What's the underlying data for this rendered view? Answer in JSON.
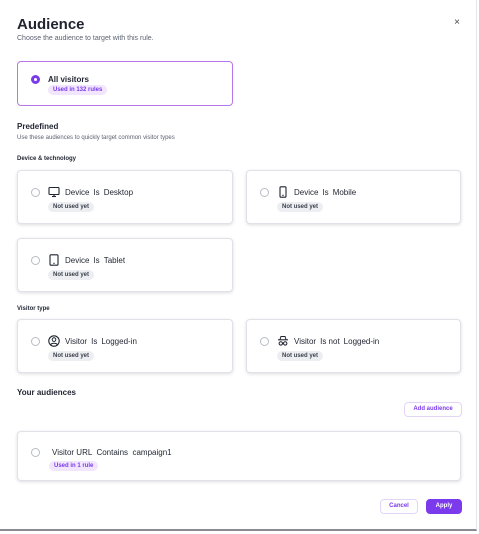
{
  "modal": {
    "title": "Audience",
    "subtitle": "Choose the audience to target with this rule.",
    "close_icon": "×"
  },
  "all_visitors": {
    "label": "All visitors",
    "badge": "Used in 132 rules",
    "selected": true
  },
  "predefined": {
    "title": "Predefined",
    "subtitle": "Use these audiences to quickly target common visitor types",
    "device_group": "Device & technology",
    "visitor_group": "Visitor type",
    "items": [
      {
        "subject": "Device",
        "op": "Is",
        "value": "Desktop",
        "badge": "Not used yet",
        "icon": "desktop-icon"
      },
      {
        "subject": "Device",
        "op": "Is",
        "value": "Mobile",
        "badge": "Not used yet",
        "icon": "mobile-icon"
      },
      {
        "subject": "Device",
        "op": "Is",
        "value": "Tablet",
        "badge": "Not used yet",
        "icon": "tablet-icon"
      },
      {
        "subject": "Visitor",
        "op": "Is",
        "value": "Logged-in",
        "badge": "Not used yet",
        "icon": "user-circle-icon"
      },
      {
        "subject": "Visitor",
        "op": "Is not",
        "value": "Logged-in",
        "badge": "Not used yet",
        "icon": "incognito-icon"
      }
    ]
  },
  "your_audiences": {
    "title": "Your audiences",
    "add_label": "Add audience",
    "items": [
      {
        "label": "Visitor URL  Contains  campaign1",
        "badge": "Used in 1 rule"
      }
    ]
  },
  "footer": {
    "cancel_label": "Cancel",
    "apply_label": "Apply"
  },
  "colors": {
    "accent": "#7c3aed",
    "accent_light": "#f1e6fd",
    "selected_border": "#b777ea"
  }
}
